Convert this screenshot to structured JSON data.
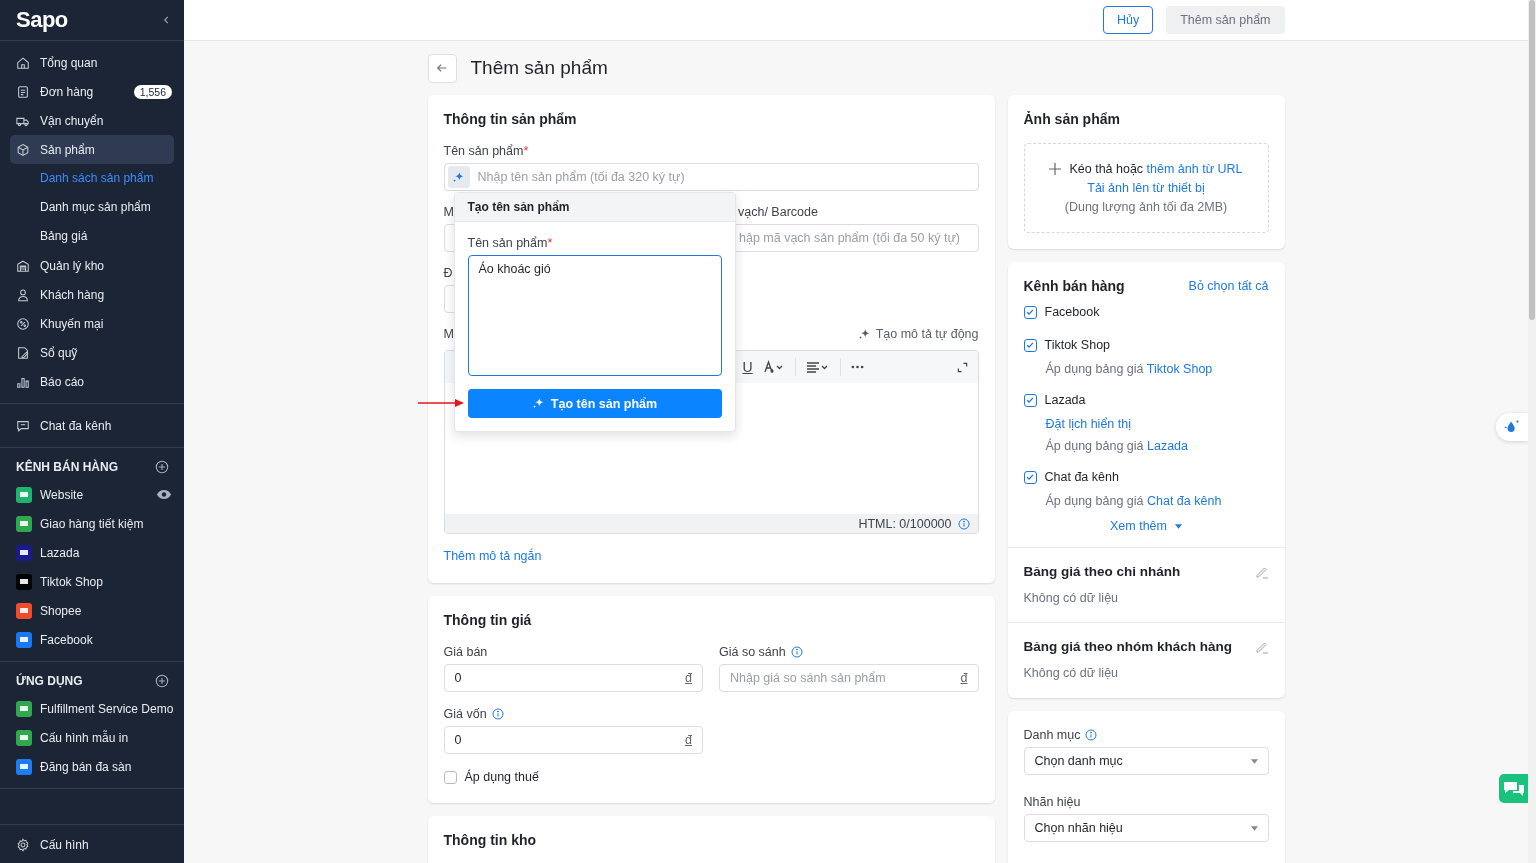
{
  "sidebar": {
    "logo": "Sapo",
    "nav_groups": [
      {
        "items": [
          {
            "label": "Tổng quan",
            "selected": false
          },
          {
            "label": "Đơn hàng",
            "selected": false,
            "badge": "1,556"
          },
          {
            "label": "Vận chuyển",
            "selected": false
          },
          {
            "label": "Sản phẩm",
            "selected": true,
            "children": [
              {
                "label": "Danh sách sản phẩm",
                "selected": true
              },
              {
                "label": "Danh mục sản phẩm",
                "selected": false
              },
              {
                "label": "Bảng giá",
                "selected": false
              }
            ]
          },
          {
            "label": "Quản lý kho",
            "selected": false
          },
          {
            "label": "Khách hàng",
            "selected": false
          },
          {
            "label": "Khuyến mại",
            "selected": false
          },
          {
            "label": "Sổ quỹ",
            "selected": false
          },
          {
            "label": "Báo cáo",
            "selected": false
          }
        ]
      },
      {
        "items": [
          {
            "label": "Chat đa kênh",
            "selected": false
          }
        ]
      }
    ],
    "sections": [
      {
        "title": "KÊNH BÁN HÀNG",
        "items": [
          {
            "label": "Website",
            "color": "#1fb46e",
            "eye": true
          },
          {
            "label": "Giao hàng tiết kiệm",
            "color": "#2fa84f"
          },
          {
            "label": "Lazada",
            "color": "#1a1a8c"
          },
          {
            "label": "Tiktok Shop",
            "color": "#000000"
          },
          {
            "label": "Shopee",
            "color": "#ee4d2d"
          },
          {
            "label": "Facebook",
            "color": "#1877f2"
          }
        ]
      },
      {
        "title": "ỨNG DỤNG",
        "items": [
          {
            "label": "Fulfillment Service Demo",
            "color": "#2fa84f"
          },
          {
            "label": "Cấu hình mẫu in",
            "color": "#2fa84f"
          },
          {
            "label": "Đăng bán đa sàn",
            "color": "#1c7cf0"
          }
        ]
      }
    ],
    "footer_item": "Cấu hình"
  },
  "topbar": {
    "buttons": [
      {
        "label": "Hủy",
        "kind": "outline"
      },
      {
        "label": "Thêm sản phẩm",
        "kind": "secondary"
      }
    ]
  },
  "page": {
    "title": "Thêm sản phẩm"
  },
  "product_info": {
    "title": "Thông tin sản phẩm",
    "name_field": {
      "label": "Tên sản phẩm",
      "required_mark": "*",
      "placeholder": "Nhập tên sản phẩm (tối đa 320 ký tự)"
    },
    "row2_left_label": "M",
    "barcode_label": "vạch/ Barcode",
    "barcode_placeholder": "hập mã vạch sản phẩm (tối đa 50 ký tự)",
    "row3_left_label": "Đ",
    "description_label": "M",
    "auto_description": "Tạo mô tả tự động",
    "editor_toolbar": [
      {
        "kind": "underline",
        "label": "U"
      },
      {
        "kind": "font-color"
      },
      {
        "kind": "align"
      },
      {
        "kind": "more"
      }
    ],
    "html_counter": "HTML: 0/100000",
    "short_description_link": "Thêm mô tả ngắn"
  },
  "popover": {
    "title": "Tạo tên sản phẩm",
    "label": "Tên sản phẩm",
    "required_mark": "*",
    "value": "Áo khoác gió",
    "button": "Tạo tên sản phẩm"
  },
  "pricing": {
    "title": "Thông tin giá",
    "fields": [
      {
        "label": "Giá bán",
        "info": false,
        "value": "0",
        "unit": "đ"
      },
      {
        "label": "Giá so sánh",
        "info": true,
        "placeholder": "Nhập giá so sánh sản phẩm",
        "unit": "đ"
      },
      {
        "label": "Giá vốn",
        "info": true,
        "value": "0",
        "unit": "đ"
      }
    ],
    "tax": {
      "label": "Áp dụng thuế",
      "checked": false
    }
  },
  "inventory": {
    "title": "Thông tin kho"
  },
  "images": {
    "title": "Ảnh sản phẩm",
    "drop_text": "Kéo thả hoặc ",
    "url_link": "thêm ảnh từ URL",
    "upload_link": "Tải ảnh lên từ thiết bị",
    "limit": "(Dung lượng ảnh tối đa 2MB)"
  },
  "sales_channels": {
    "title": "Kênh bán hàng",
    "deselect_all": "Bỏ chọn tất cả",
    "channels": [
      {
        "name": "Facebook",
        "checked": true
      },
      {
        "name": "Tiktok Shop",
        "checked": true,
        "price_prefix": "Áp dụng bảng giá ",
        "price_link": "Tiktok Shop"
      },
      {
        "name": "Lazada",
        "checked": true,
        "schedule_link": "Đặt lịch hiển thị",
        "price_prefix": "Áp dụng bảng giá ",
        "price_link": "Lazada"
      },
      {
        "name": "Chat đa kênh",
        "checked": true,
        "price_prefix": "Áp dụng bảng giá ",
        "price_link": "Chat đa kênh"
      }
    ],
    "more": "Xem thêm"
  },
  "price_lists": [
    {
      "title": "Bảng giá theo chi nhánh",
      "empty_text": "Không có dữ liệu"
    },
    {
      "title": "Bảng giá theo nhóm khách hàng",
      "empty_text": "Không có dữ liệu"
    }
  ],
  "classification": {
    "fields": [
      {
        "label": "Danh mục",
        "info": true,
        "value": "Chọn danh mục"
      },
      {
        "label": "Nhãn hiệu",
        "info": false,
        "value": "Chọn nhãn hiệu"
      }
    ]
  }
}
